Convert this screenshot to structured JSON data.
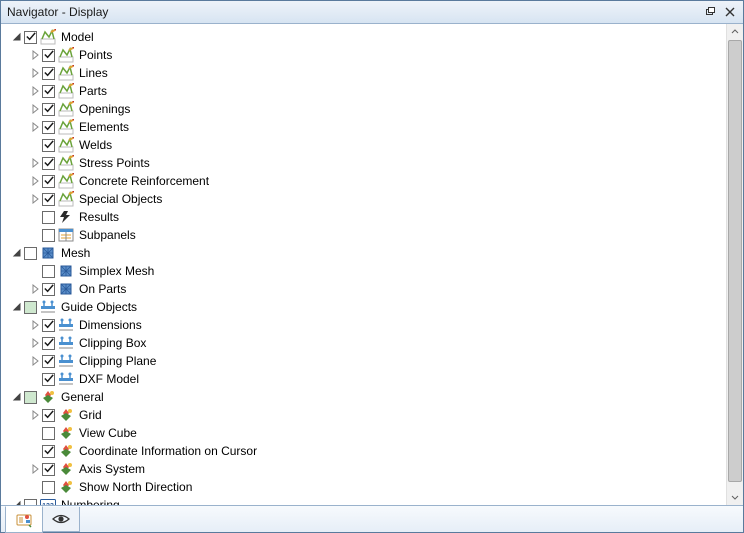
{
  "title": "Navigator - Display",
  "tree": [
    {
      "id": "model",
      "label": "Model",
      "checked": true,
      "expanded": true,
      "twisty": "down",
      "icon": "model",
      "depth": 0,
      "children": [
        {
          "id": "points",
          "label": "Points",
          "checked": true,
          "twisty": "right",
          "icon": "model",
          "depth": 1
        },
        {
          "id": "lines",
          "label": "Lines",
          "checked": true,
          "twisty": "right",
          "icon": "model",
          "depth": 1
        },
        {
          "id": "parts",
          "label": "Parts",
          "checked": true,
          "twisty": "right",
          "icon": "model",
          "depth": 1
        },
        {
          "id": "openings",
          "label": "Openings",
          "checked": true,
          "twisty": "right",
          "icon": "model",
          "depth": 1
        },
        {
          "id": "elements",
          "label": "Elements",
          "checked": true,
          "twisty": "right",
          "icon": "model",
          "depth": 1
        },
        {
          "id": "welds",
          "label": "Welds",
          "checked": true,
          "twisty": "none",
          "icon": "model",
          "depth": 1
        },
        {
          "id": "stress",
          "label": "Stress Points",
          "checked": true,
          "twisty": "right",
          "icon": "model",
          "depth": 1
        },
        {
          "id": "reinf",
          "label": "Concrete Reinforcement",
          "checked": true,
          "twisty": "right",
          "icon": "model",
          "depth": 1
        },
        {
          "id": "special",
          "label": "Special Objects",
          "checked": true,
          "twisty": "right",
          "icon": "model",
          "depth": 1
        }
      ]
    },
    {
      "id": "results",
      "label": "Results",
      "checked": false,
      "twisty": "none",
      "icon": "results",
      "depth": 0,
      "indent": 1
    },
    {
      "id": "subpanels",
      "label": "Subpanels",
      "checked": false,
      "twisty": "none",
      "icon": "subpanels",
      "depth": 0,
      "indent": 1
    },
    {
      "id": "mesh",
      "label": "Mesh",
      "checked": false,
      "expanded": true,
      "twisty": "down",
      "icon": "mesh",
      "depth": 0,
      "children": [
        {
          "id": "simplex",
          "label": "Simplex Mesh",
          "checked": false,
          "twisty": "none",
          "icon": "mesh",
          "depth": 1
        },
        {
          "id": "onparts",
          "label": "On Parts",
          "checked": true,
          "twisty": "right",
          "icon": "mesh",
          "depth": 1
        }
      ]
    },
    {
      "id": "guide",
      "label": "Guide Objects",
      "checked": "tri",
      "expanded": true,
      "twisty": "down",
      "icon": "guide",
      "depth": 0,
      "children": [
        {
          "id": "dims",
          "label": "Dimensions",
          "checked": true,
          "twisty": "right",
          "icon": "guide",
          "depth": 1
        },
        {
          "id": "cbox",
          "label": "Clipping Box",
          "checked": true,
          "twisty": "right",
          "icon": "guide",
          "depth": 1
        },
        {
          "id": "cplane",
          "label": "Clipping Plane",
          "checked": true,
          "twisty": "right",
          "icon": "guide",
          "depth": 1
        },
        {
          "id": "dxf",
          "label": "DXF Model",
          "checked": true,
          "twisty": "none",
          "icon": "guide",
          "depth": 1
        }
      ]
    },
    {
      "id": "general",
      "label": "General",
      "checked": "tri",
      "expanded": true,
      "twisty": "down",
      "icon": "general",
      "depth": 0,
      "children": [
        {
          "id": "grid",
          "label": "Grid",
          "checked": true,
          "twisty": "right",
          "icon": "general",
          "depth": 1
        },
        {
          "id": "viewcube",
          "label": "View Cube",
          "checked": false,
          "twisty": "none",
          "icon": "general",
          "depth": 1
        },
        {
          "id": "coord",
          "label": "Coordinate Information on Cursor",
          "checked": true,
          "twisty": "none",
          "icon": "general",
          "depth": 1
        },
        {
          "id": "axis",
          "label": "Axis System",
          "checked": true,
          "twisty": "right",
          "icon": "general",
          "depth": 1
        },
        {
          "id": "north",
          "label": "Show North Direction",
          "checked": false,
          "twisty": "none",
          "icon": "general",
          "depth": 1
        }
      ]
    },
    {
      "id": "numbering",
      "label": "Numbering",
      "checked": false,
      "twisty": "down",
      "icon": "numbering",
      "depth": 0
    }
  ],
  "tabs": [
    {
      "id": "tab-data",
      "icon": "tab-data",
      "active": true
    },
    {
      "id": "tab-eye",
      "icon": "eye",
      "active": false
    }
  ],
  "scroll": {
    "thumbTop": 0,
    "thumbHeight": 440
  }
}
